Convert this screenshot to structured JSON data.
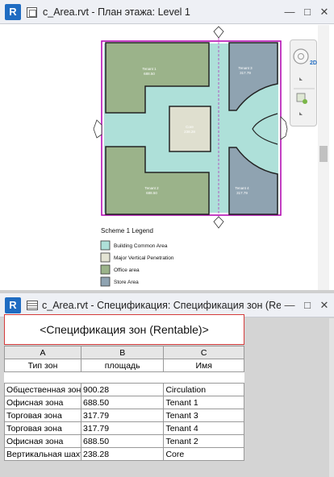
{
  "plan_window": {
    "app_badge": "R",
    "title": "c_Area.rvt - План этажа: Level 1",
    "minimize": "—",
    "maximize": "□",
    "close": "✕",
    "view_cube_label": "2D",
    "rooms": [
      {
        "name": "Tenant 1",
        "area": "688.50",
        "fill": "#9bb38a"
      },
      {
        "name": "Tenant 3",
        "area": "317.79",
        "fill": "#8fa3b1"
      },
      {
        "name": "Core",
        "area": "238.28",
        "fill": "#dfdfcf"
      },
      {
        "name": "Tenant 2",
        "area": "688.50",
        "fill": "#9bb38a"
      },
      {
        "name": "Tenant 4",
        "area": "317.79",
        "fill": "#8fa3b1"
      }
    ],
    "legend": {
      "title": "Scheme 1 Legend",
      "items": [
        {
          "label": "Building Common Area",
          "color": "#aee0d9"
        },
        {
          "label": "Major Vertical Penetration",
          "color": "#e4e4d4"
        },
        {
          "label": "Office area",
          "color": "#9bb38a"
        },
        {
          "label": "Store Area",
          "color": "#8fa3b1"
        }
      ]
    }
  },
  "schedule_window": {
    "app_badge": "R",
    "title": "c_Area.rvt - Спецификация: Спецификация зон (Rentable)",
    "minimize": "—",
    "maximize": "□",
    "close": "✕",
    "schedule_title": "<Спецификация зон (Rentable)>",
    "column_letters": [
      "A",
      "B",
      "C"
    ],
    "column_headers": [
      "Тип зон",
      "площадь",
      "Имя"
    ],
    "rows": [
      [
        "Общественная зона",
        "900.28",
        "Circulation"
      ],
      [
        "Офисная зона",
        "688.50",
        "Tenant 1"
      ],
      [
        "Торговая зона",
        "317.79",
        "Tenant 3"
      ],
      [
        "Торговая зона",
        "317.79",
        "Tenant 4"
      ],
      [
        "Офисная зона",
        "688.50",
        "Tenant 2"
      ],
      [
        "Вертикальная шахта",
        "238.28",
        "Core"
      ]
    ]
  }
}
